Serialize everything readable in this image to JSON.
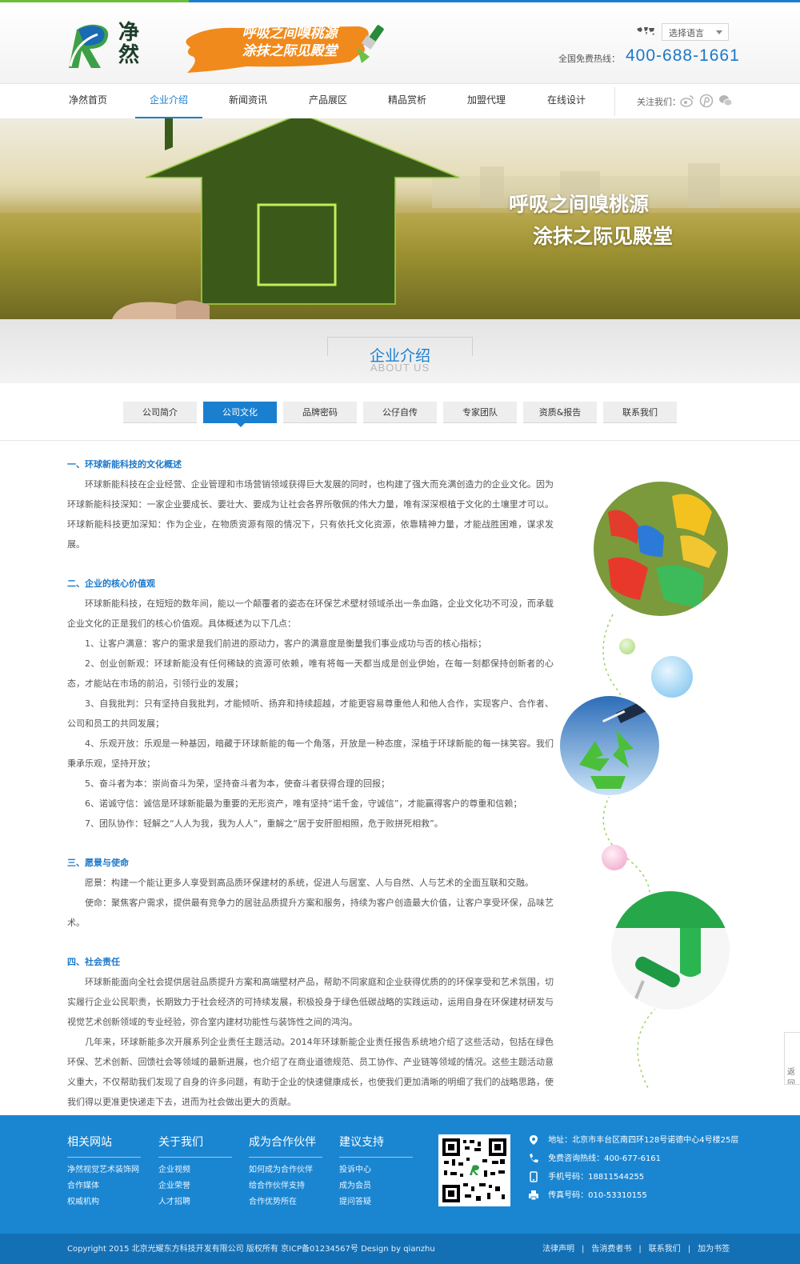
{
  "header": {
    "logo_text": "净然",
    "slogan_line1": "呼吸之间嗅桃源",
    "slogan_line2": "涂抹之际见殿堂",
    "language_select": "选择语言",
    "hotline_label": "全国免费热线：",
    "hotline_number": "400-688-1661"
  },
  "nav": {
    "items": [
      {
        "label": "净然首页"
      },
      {
        "label": "企业介绍",
        "active": true
      },
      {
        "label": "新闻资讯"
      },
      {
        "label": "产品展区"
      },
      {
        "label": "精品赏析"
      },
      {
        "label": "加盟代理"
      },
      {
        "label": "在线设计"
      }
    ],
    "follow_label": "关注我们：",
    "social_icons": [
      "weibo-icon",
      "pinterest-icon",
      "wechat-icon"
    ]
  },
  "banner": {
    "line1": "呼吸之间嗅桃源",
    "line2": "涂抹之际见殿堂"
  },
  "section": {
    "title_cn": "企业介绍",
    "title_en": "ABOUT US"
  },
  "tabs": [
    {
      "label": "公司简介"
    },
    {
      "label": "公司文化",
      "active": true
    },
    {
      "label": "品牌密码"
    },
    {
      "label": "公仔自传"
    },
    {
      "label": "专家团队"
    },
    {
      "label": "资质&报告"
    },
    {
      "label": "联系我们"
    }
  ],
  "content": {
    "s1_title": "一、环球新能科技的文化概述",
    "s1_p1": "环球新能科技在企业经营、企业管理和市场营销领域获得巨大发展的同时，也构建了强大而充满创造力的企业文化。因为环球新能科技深知：一家企业要成长、要壮大、要成为让社会各界所敬佩的伟大力量，唯有深深根植于文化的土壤里才可以。环球新能科技更加深知：作为企业，在物质资源有限的情况下，只有依托文化资源，依靠精神力量，才能战胜困难，谋求发展。",
    "s2_title": "二、企业的核心价值观",
    "s2_p1": "环球新能科技，在短短的数年间，能以一个颠覆者的姿态在环保艺术壁材领域杀出一条血路，企业文化功不可没，而承载企业文化的正是我们的核心价值观。具体概述为以下几点：",
    "s2_i1": "1、让客户满意：客户的需求是我们前进的原动力，客户的满意度是衡量我们事业成功与否的核心指标；",
    "s2_i2": "2、创业创新观：环球新能没有任何稀缺的资源可依赖，唯有将每一天都当成是创业伊始，在每一刻都保持创新者的心态，才能站在市场的前沿，引领行业的发展；",
    "s2_i3": "3、自我批判：只有坚持自我批判，才能倾听、扬弃和持续超越，才能更容易尊重他人和他人合作，实现客户、合作者、公司和员工的共同发展；",
    "s2_i4": "4、乐观开放：乐观是一种基因，暗藏于环球新能的每一个角落，开放是一种态度，深植于环球新能的每一抹笑容。我们秉承乐观，坚持开放；",
    "s2_i5": "5、奋斗者为本：崇尚奋斗为荣，坚持奋斗者为本，使奋斗者获得合理的回报；",
    "s2_i6": "6、诺诚守信：诚信是环球新能最为重要的无形资产，唯有坚持“诺千金，守诚信”，才能赢得客户的尊重和信赖；",
    "s2_i7": "7、团队协作：轻解之“人人为我，我为人人”，重解之“居于安肝胆相照，危于败拼死相救”。",
    "s3_title": "三、愿景与使命",
    "s3_p1": "愿景：构建一个能让更多人享受到高品质环保建材的系统，促进人与居室、人与自然、人与艺术的全面互联和交融。",
    "s3_p2": "使命：聚焦客户需求，提供最有竞争力的居驻品质提升方案和服务，持续为客户创造最大价值，让客户享受环保，品味艺术。",
    "s4_title": "四、社会责任",
    "s4_p1": "环球新能面向全社会提供居驻品质提升方案和高端壁材产品，帮助不同家庭和企业获得优质的的环保享受和艺术氛围，切实履行企业公民职责，长期致力于社会经济的可持续发展，积极投身于绿色低碳战略的实践运动，运用自身在环保建材研发与视觉艺术创新领域的专业经验，弥合室内建材功能性与装饰性之间的鸿沟。",
    "s4_p2": "几年来，环球新能多次开展系列企业责任主题活动。2014年环球新能企业责任报告系统地介绍了这些活动，包括在绿色环保、艺术创新、回馈社会等领域的最新进展，也介绍了在商业道德规范、员工协作、产业链等领域的情况。这些主题活动意义重大，不仅帮助我们发现了自身的许多问题，有助于企业的快速健康成长，也使我们更加清晰的明细了我们的战略思路，使我们得以更准更快递走下去，进而为社会做出更大的贡献。"
  },
  "side_widget": {
    "label": "返回"
  },
  "footer": {
    "cols": [
      {
        "title": "相关网站",
        "links": [
          "净然视觉艺术装饰网",
          "合作媒体",
          "权威机构"
        ]
      },
      {
        "title": "关于我们",
        "links": [
          "企业视频",
          "企业荣誉",
          "人才招聘"
        ]
      },
      {
        "title": "成为合作伙伴",
        "links": [
          "如何成为合作伙伴",
          "给合作伙伴支持",
          "合作优势所在"
        ]
      },
      {
        "title": "建议支持",
        "links": [
          "投诉中心",
          "成为会员",
          "提问答疑"
        ]
      }
    ],
    "contact": {
      "address": "地址：北京市丰台区南四环128号诺德中心4号楼25层",
      "free_line": "免费咨询热线：400-677-6161",
      "mobile": "手机号码：18811544255",
      "fax": "传真号码：010-53310155"
    },
    "copyright": "Copyright 2015 北京光耀东方科技开发有限公司 版权所有   京ICP备01234567号  Design by qianzhu",
    "bottom_links": [
      "法律声明",
      "告消费者书",
      "联系我们",
      "加为书签"
    ]
  },
  "colors": {
    "brand_blue": "#1a7fcf",
    "footer_blue": "#1a86d2",
    "brand_green": "#6abf3a"
  }
}
